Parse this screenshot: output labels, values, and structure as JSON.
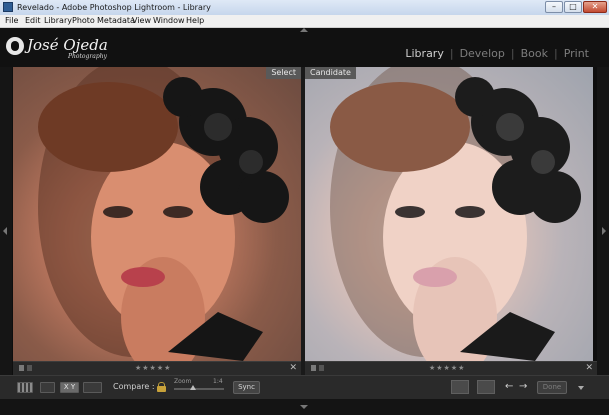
{
  "window": {
    "title": "Revelado - Adobe Photoshop Lightroom - Library"
  },
  "menu": [
    "File",
    "Edit",
    "Library",
    "Photo",
    "Metadata",
    "View",
    "Window",
    "Help"
  ],
  "logo": {
    "name": "José Ojeda",
    "subtitle": "Photography"
  },
  "modules": [
    "Library",
    "Develop",
    "Book",
    "Print"
  ],
  "panes": {
    "left": {
      "tag": "Select",
      "stars": "★★★★★",
      "close": "✕"
    },
    "right": {
      "tag": "Candidate",
      "stars": "★★★★★",
      "close": "✕"
    }
  },
  "toolbar": {
    "xy_label": "X Y",
    "compare_label": "Compare :",
    "zoom_label": "Zoom",
    "ratio_label": "1:4",
    "sync_label": "Sync",
    "done_label": "Done",
    "prev_arrow": "←",
    "next_arrow": "→"
  },
  "colors": {
    "background": "#0e0e0e",
    "panel": "#2a2a2a",
    "tag_bg": "#595959"
  }
}
